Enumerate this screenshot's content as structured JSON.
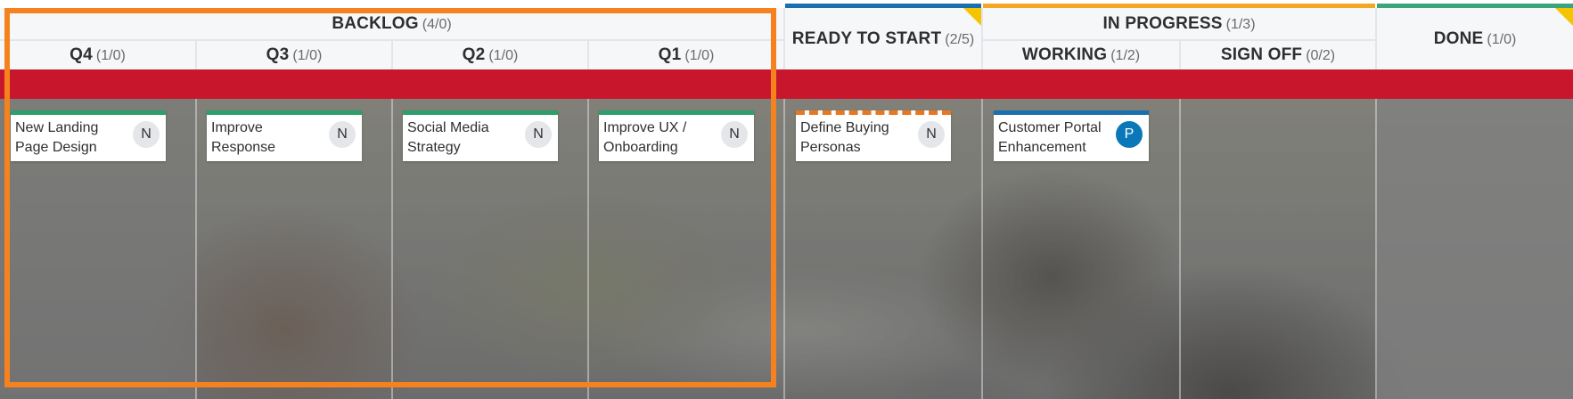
{
  "columns": {
    "backlog": {
      "title": "BACKLOG",
      "count": "(4/0)"
    },
    "q4": {
      "title": "Q4",
      "count": "(1/0)"
    },
    "q3": {
      "title": "Q3",
      "count": "(1/0)"
    },
    "q2": {
      "title": "Q2",
      "count": "(1/0)"
    },
    "q1": {
      "title": "Q1",
      "count": "(1/0)"
    },
    "ready": {
      "title": "READY TO START",
      "count": "(2/5)"
    },
    "in_progress": {
      "title": "IN PROGRESS",
      "count": "(1/3)"
    },
    "working": {
      "title": "WORKING",
      "count": "(1/2)"
    },
    "sign_off": {
      "title": "SIGN OFF",
      "count": "(0/2)"
    },
    "done": {
      "title": "DONE",
      "count": "(1/0)"
    }
  },
  "cards": [
    {
      "title": "New Landing Page Design",
      "badge": "N"
    },
    {
      "title": "Improve Response",
      "badge": "N"
    },
    {
      "title": "Social Media Strategy",
      "badge": "N"
    },
    {
      "title": "Improve UX / Onboarding",
      "badge": "N"
    },
    {
      "title": "Define Buying Personas",
      "badge": "N"
    },
    {
      "title": "Customer Portal Enhancement",
      "badge": "P"
    }
  ],
  "colors": {
    "swimlane": "#c8172d",
    "accent_green": "#2e9e6b",
    "accent_blue": "#1a6fb0",
    "accent_orange": "#f5a623",
    "accent_teal": "#3aa57a",
    "selection_outline": "#f5821f"
  }
}
